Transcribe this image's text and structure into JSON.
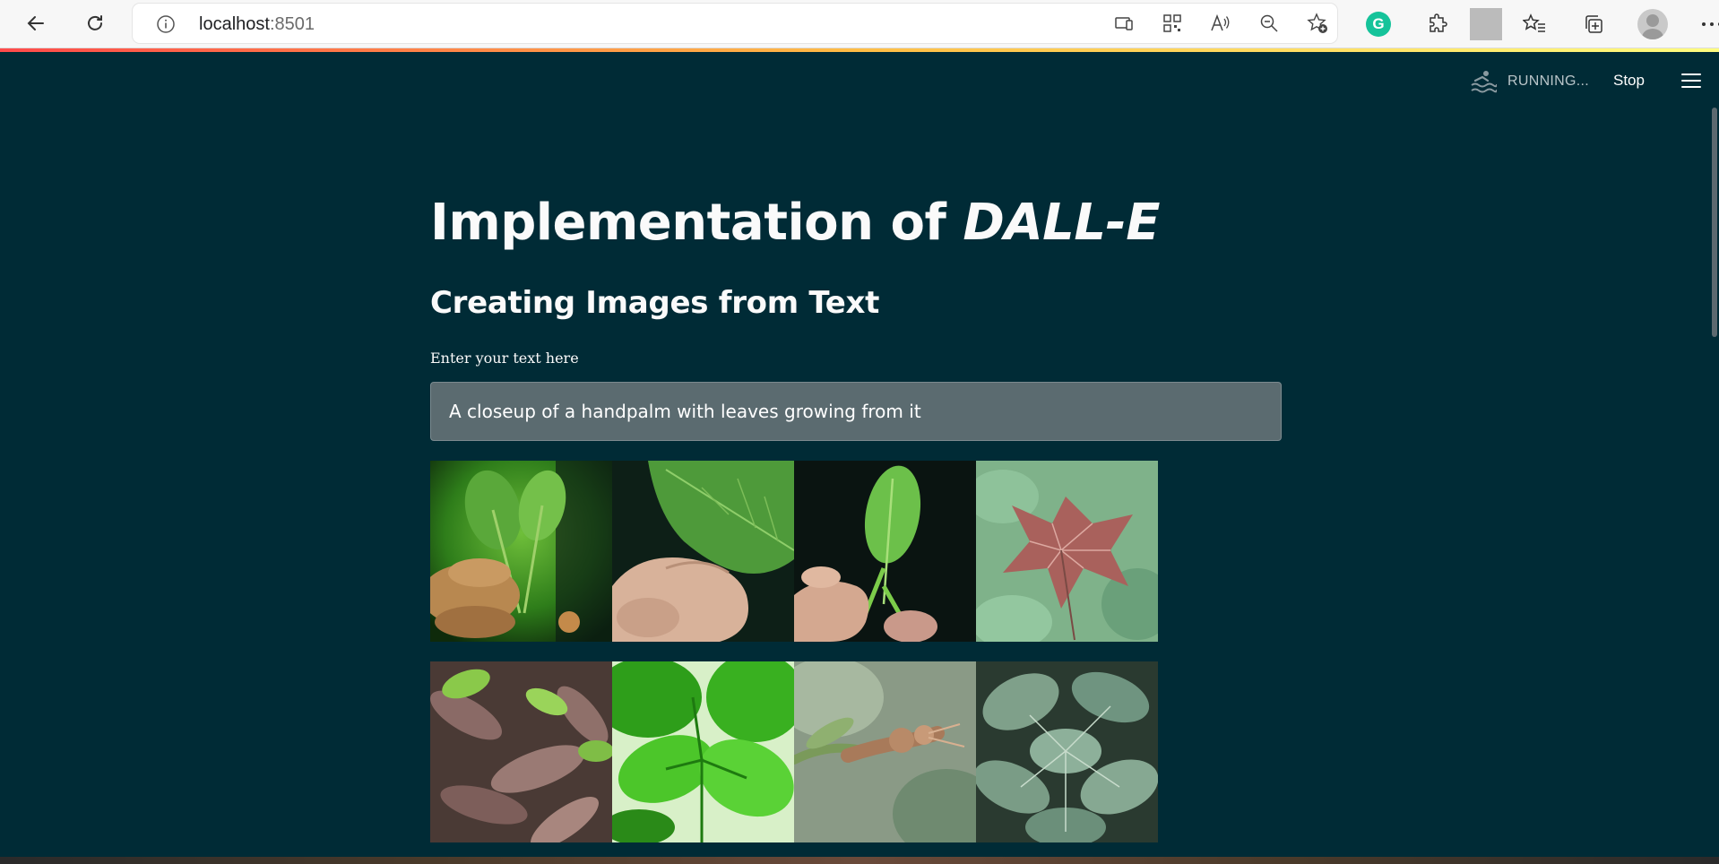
{
  "browser": {
    "url_host": "localhost",
    "url_port": ":8501"
  },
  "app_header": {
    "status_label": "RUNNING...",
    "stop_label": "Stop"
  },
  "main": {
    "title_plain": "Implementation of ",
    "title_italic": "DALL-E",
    "subtitle": "Creating Images from Text",
    "input_label": "Enter your text here",
    "input_value": "A closeup of a handpalm with leaves growing from it"
  }
}
